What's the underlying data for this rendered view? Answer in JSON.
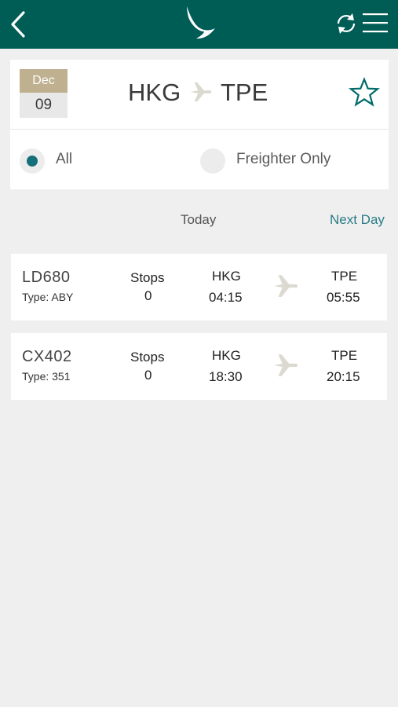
{
  "search": {
    "date_month": "Dec",
    "date_day": "09",
    "origin": "HKG",
    "destination": "TPE"
  },
  "filters": {
    "all_label": "All",
    "freighter_label": "Freighter Only",
    "selected": "All"
  },
  "day_nav": {
    "today_label": "Today",
    "next_day_label": "Next Day"
  },
  "flights": [
    {
      "number": "LD680",
      "type": "Type: ABY",
      "stops_label": "Stops",
      "stops": "0",
      "dep_code": "HKG",
      "dep_time": "04:15",
      "arr_code": "TPE",
      "arr_time": "05:55"
    },
    {
      "number": "CX402",
      "type": "Type: 351",
      "stops_label": "Stops",
      "stops": "0",
      "dep_code": "HKG",
      "dep_time": "18:30",
      "arr_code": "TPE",
      "arr_time": "20:15"
    }
  ],
  "icons": {
    "back": "chevron-left-icon",
    "logo": "brushwing-logo",
    "refresh": "refresh-icon",
    "menu": "hamburger-menu-icon",
    "favorite": "star-outline-icon",
    "plane": "plane-icon"
  },
  "colors": {
    "header": "#005d56",
    "accent": "#136f79",
    "date_month_bg": "#bfb090",
    "next_day": "#2a7c86",
    "background": "#efefef"
  }
}
